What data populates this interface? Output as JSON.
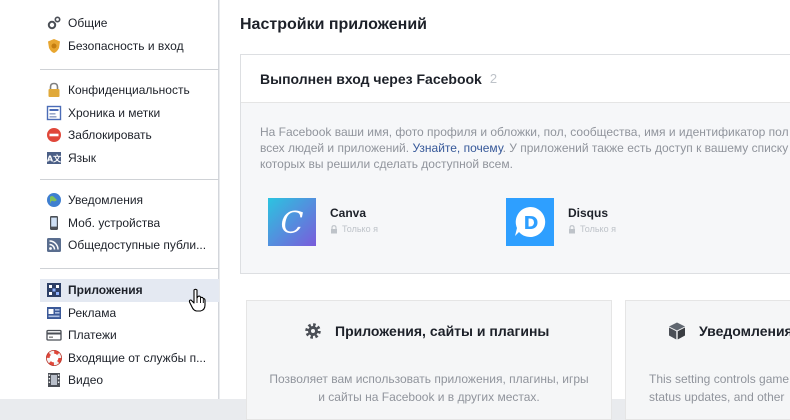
{
  "sidebar": {
    "groups": [
      {
        "items": [
          {
            "label": "Общие",
            "icon": "gears-icon"
          },
          {
            "label": "Безопасность и вход",
            "icon": "shield-badge-icon"
          }
        ]
      },
      {
        "items": [
          {
            "label": "Конфиденциальность",
            "icon": "padlock-icon"
          },
          {
            "label": "Хроника и метки",
            "icon": "timeline-icon"
          },
          {
            "label": "Заблокировать",
            "icon": "block-icon"
          },
          {
            "label": "Язык",
            "icon": "language-icon"
          }
        ]
      },
      {
        "items": [
          {
            "label": "Уведомления",
            "icon": "globe-icon"
          },
          {
            "label": "Моб. устройства",
            "icon": "mobile-icon"
          },
          {
            "label": "Общедоступные публи...",
            "icon": "rss-icon"
          }
        ]
      },
      {
        "items": [
          {
            "label": "Приложения",
            "icon": "apps-icon",
            "active": true
          },
          {
            "label": "Реклама",
            "icon": "ads-icon"
          },
          {
            "label": "Платежи",
            "icon": "payments-icon"
          },
          {
            "label": "Входящие от службы п...",
            "icon": "lifebuoy-icon"
          },
          {
            "label": "Видео",
            "icon": "film-icon"
          }
        ]
      }
    ]
  },
  "main": {
    "title": "Настройки приложений",
    "login_card": {
      "heading": "Выполнен вход через Facebook",
      "count": "2",
      "description_line1": "На Facebook ваши имя, фото профиля и обложки, пол, сообщества, имя и идентификатор пол",
      "description_line2_before": "всех людей и приложений. ",
      "description_link": "Узнайте, почему",
      "description_line2_after": ". У приложений также есть доступ к вашему списку",
      "description_line3": "которых вы решили сделать доступной всем.",
      "apps": [
        {
          "name": "Canva",
          "visibility": "Только я",
          "logo_letter": "C",
          "color": "#3b8fd6"
        },
        {
          "name": "Disqus",
          "visibility": "Только я",
          "logo_letter": "D",
          "color": "#2e9fff"
        }
      ]
    },
    "tiles": [
      {
        "title": "Приложения, сайты и плагины",
        "text": [
          "Позволяет вам использовать приложения, плагины, игры",
          "и сайты на Facebook и в других местах."
        ],
        "icon": "gear-icon"
      },
      {
        "title": "Уведомления",
        "text": [
          "This setting controls game",
          "status updates, and other"
        ],
        "icon": "cube-icon"
      }
    ]
  },
  "colors": {
    "link": "#365899",
    "active_bg": "#e4e9f2",
    "muted": "#90949c"
  }
}
